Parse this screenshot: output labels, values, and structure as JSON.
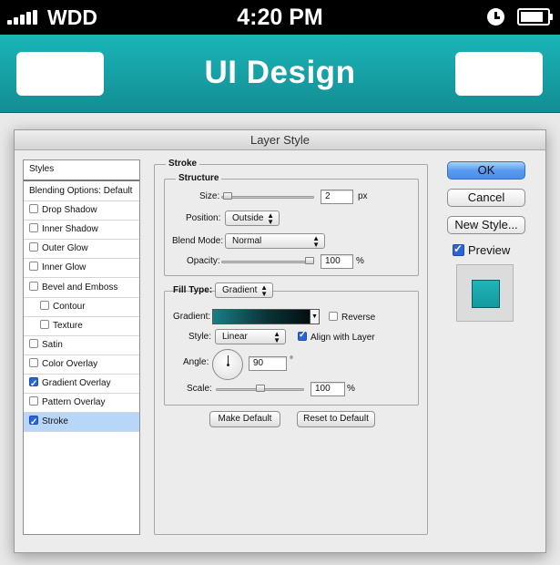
{
  "status_bar": {
    "carrier": "WDD",
    "time": "4:20 PM",
    "battery_level": 0.85
  },
  "app_header": {
    "title": "UI Design",
    "accent_color": "#18a9ad"
  },
  "dialog": {
    "title": "Layer Style",
    "styles_list": [
      {
        "label": "Styles",
        "has_checkbox": false,
        "checked": false,
        "indent": false,
        "selected": false
      },
      {
        "label": "Blending Options: Default",
        "has_checkbox": false,
        "checked": false,
        "indent": false,
        "selected": false
      },
      {
        "label": "Drop Shadow",
        "has_checkbox": true,
        "checked": false,
        "indent": false,
        "selected": false
      },
      {
        "label": "Inner Shadow",
        "has_checkbox": true,
        "checked": false,
        "indent": false,
        "selected": false
      },
      {
        "label": "Outer Glow",
        "has_checkbox": true,
        "checked": false,
        "indent": false,
        "selected": false
      },
      {
        "label": "Inner Glow",
        "has_checkbox": true,
        "checked": false,
        "indent": false,
        "selected": false
      },
      {
        "label": "Bevel and Emboss",
        "has_checkbox": true,
        "checked": false,
        "indent": false,
        "selected": false
      },
      {
        "label": "Contour",
        "has_checkbox": true,
        "checked": false,
        "indent": true,
        "selected": false
      },
      {
        "label": "Texture",
        "has_checkbox": true,
        "checked": false,
        "indent": true,
        "selected": false
      },
      {
        "label": "Satin",
        "has_checkbox": true,
        "checked": false,
        "indent": false,
        "selected": false
      },
      {
        "label": "Color Overlay",
        "has_checkbox": true,
        "checked": false,
        "indent": false,
        "selected": false
      },
      {
        "label": "Gradient Overlay",
        "has_checkbox": true,
        "checked": true,
        "indent": false,
        "selected": false
      },
      {
        "label": "Pattern Overlay",
        "has_checkbox": true,
        "checked": false,
        "indent": false,
        "selected": false
      },
      {
        "label": "Stroke",
        "has_checkbox": true,
        "checked": true,
        "indent": false,
        "selected": true
      }
    ],
    "stroke": {
      "section_title": "Stroke",
      "structure_title": "Structure",
      "size_label": "Size:",
      "size_value": "2",
      "size_unit": "px",
      "size_slider": 0.02,
      "position_label": "Position:",
      "position_value": "Outside",
      "blend_mode_label": "Blend Mode:",
      "blend_mode_value": "Normal",
      "opacity_label": "Opacity:",
      "opacity_value": "100",
      "opacity_unit": "%",
      "opacity_slider": 1.0,
      "fill_type_label": "Fill Type:",
      "fill_type_value": "Gradient",
      "gradient_label": "Gradient:",
      "reverse_label": "Reverse",
      "reverse_checked": false,
      "style_label": "Style:",
      "style_value": "Linear",
      "align_label": "Align with Layer",
      "align_checked": true,
      "angle_label": "Angle:",
      "angle_value": "90",
      "angle_unit": "°",
      "scale_label": "Scale:",
      "scale_value": "100",
      "scale_unit": "%",
      "scale_slider": 0.5
    },
    "make_default_label": "Make Default",
    "reset_default_label": "Reset to Default",
    "ok_label": "OK",
    "cancel_label": "Cancel",
    "new_style_label": "New Style...",
    "preview_label": "Preview",
    "preview_checked": true
  }
}
